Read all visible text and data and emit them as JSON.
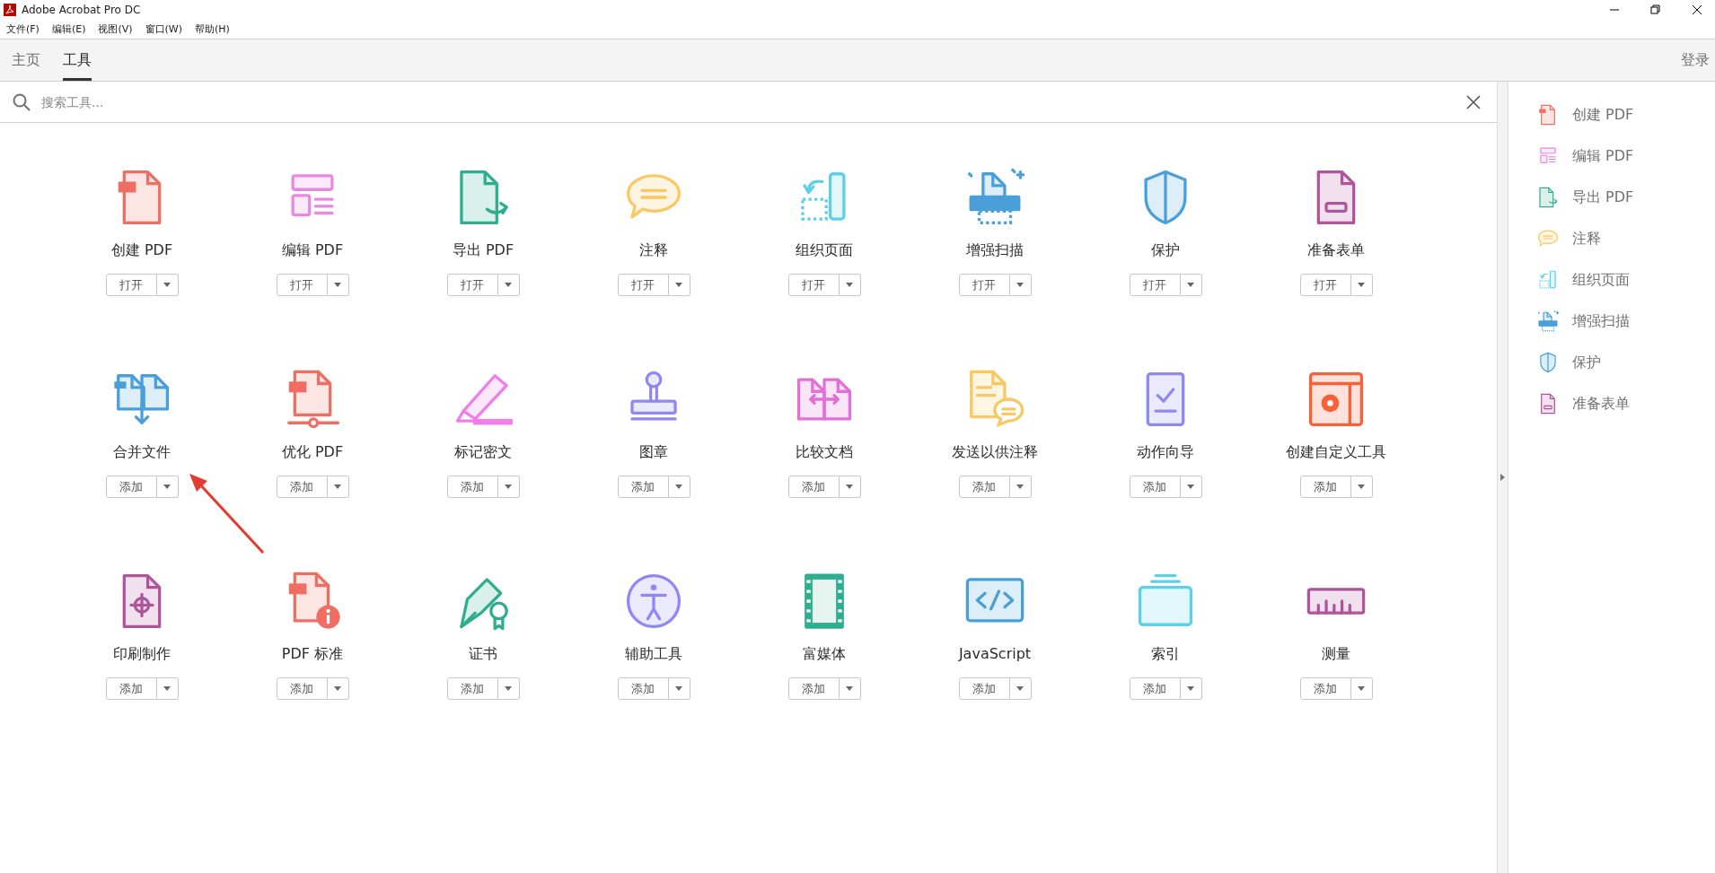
{
  "window": {
    "title": "Adobe Acrobat Pro DC"
  },
  "menu": [
    "文件(F)",
    "编辑(E)",
    "视图(V)",
    "窗口(W)",
    "帮助(H)"
  ],
  "tabs": [
    {
      "label": "主页",
      "selected": false
    },
    {
      "label": "工具",
      "selected": true
    }
  ],
  "sign_in": "登录",
  "search": {
    "placeholder": "搜索工具..."
  },
  "tools": [
    {
      "label": "创建 PDF",
      "button": "打开"
    },
    {
      "label": "编辑 PDF",
      "button": "打开"
    },
    {
      "label": "导出 PDF",
      "button": "打开"
    },
    {
      "label": "注释",
      "button": "打开"
    },
    {
      "label": "组织页面",
      "button": "打开"
    },
    {
      "label": "增强扫描",
      "button": "打开"
    },
    {
      "label": "保护",
      "button": "打开"
    },
    {
      "label": "准备表单",
      "button": "打开"
    },
    {
      "label": "合并文件",
      "button": "添加"
    },
    {
      "label": "优化 PDF",
      "button": "添加"
    },
    {
      "label": "标记密文",
      "button": "添加"
    },
    {
      "label": "图章",
      "button": "添加"
    },
    {
      "label": "比较文档",
      "button": "添加"
    },
    {
      "label": "发送以供注释",
      "button": "添加"
    },
    {
      "label": "动作向导",
      "button": "添加"
    },
    {
      "label": "创建自定义工具",
      "button": "添加"
    },
    {
      "label": "印刷制作",
      "button": "添加"
    },
    {
      "label": "PDF 标准",
      "button": "添加"
    },
    {
      "label": "证书",
      "button": "添加"
    },
    {
      "label": "辅助工具",
      "button": "添加"
    },
    {
      "label": "富媒体",
      "button": "添加"
    },
    {
      "label": "JavaScript",
      "button": "添加"
    },
    {
      "label": "索引",
      "button": "添加"
    },
    {
      "label": "测量",
      "button": "添加"
    }
  ],
  "sidebar": {
    "items": [
      "创建 PDF",
      "编辑 PDF",
      "导出 PDF",
      "注释",
      "组织页面",
      "增强扫描",
      "保护",
      "准备表单"
    ]
  }
}
